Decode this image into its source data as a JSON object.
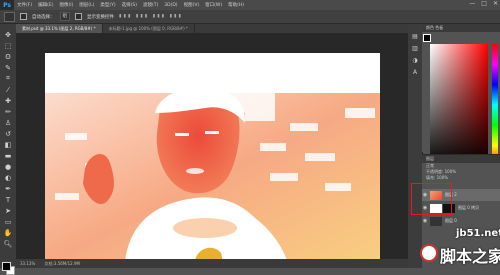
{
  "app": {
    "logo": "Ps"
  },
  "menu": [
    "文件(F)",
    "编辑(E)",
    "图像(I)",
    "图层(L)",
    "类型(Y)",
    "选择(S)",
    "滤镜(T)",
    "3D(D)",
    "视图(V)",
    "窗口(W)",
    "帮助(H)"
  ],
  "window_buttons": [
    "—",
    "□",
    "✕"
  ],
  "options_bar": {
    "auto_select_label": "自动选择：",
    "auto_select_value": "组",
    "transform_label": "显示变换控件"
  },
  "doc_tabs": [
    {
      "label": "素材.psd @ 33.1% (图层 2, RGB/8#) *",
      "active": true
    },
    {
      "label": "未标题-1.jpg @ 100% (图层 0, RGB/8#) *",
      "active": false
    }
  ],
  "status_bar": {
    "zoom": "33.13%",
    "doc_info": "文档:3.56M/12.9M"
  },
  "color_panel": {
    "tabs": "颜色  色板"
  },
  "layers_panel": {
    "header": "图层",
    "blend_mode": "正常",
    "opacity_label": "不透明度: 100%",
    "fill_label": "填充: 100%",
    "layers": [
      {
        "name": "图层 2",
        "selected": true
      },
      {
        "name": "图层 0 拷贝",
        "selected": false
      },
      {
        "name": "图层 0",
        "selected": false
      }
    ]
  },
  "colors": {
    "highlight_box": "#e51c1c"
  },
  "watermark": {
    "domain": "jb51.net",
    "brand": "脚本之家"
  }
}
